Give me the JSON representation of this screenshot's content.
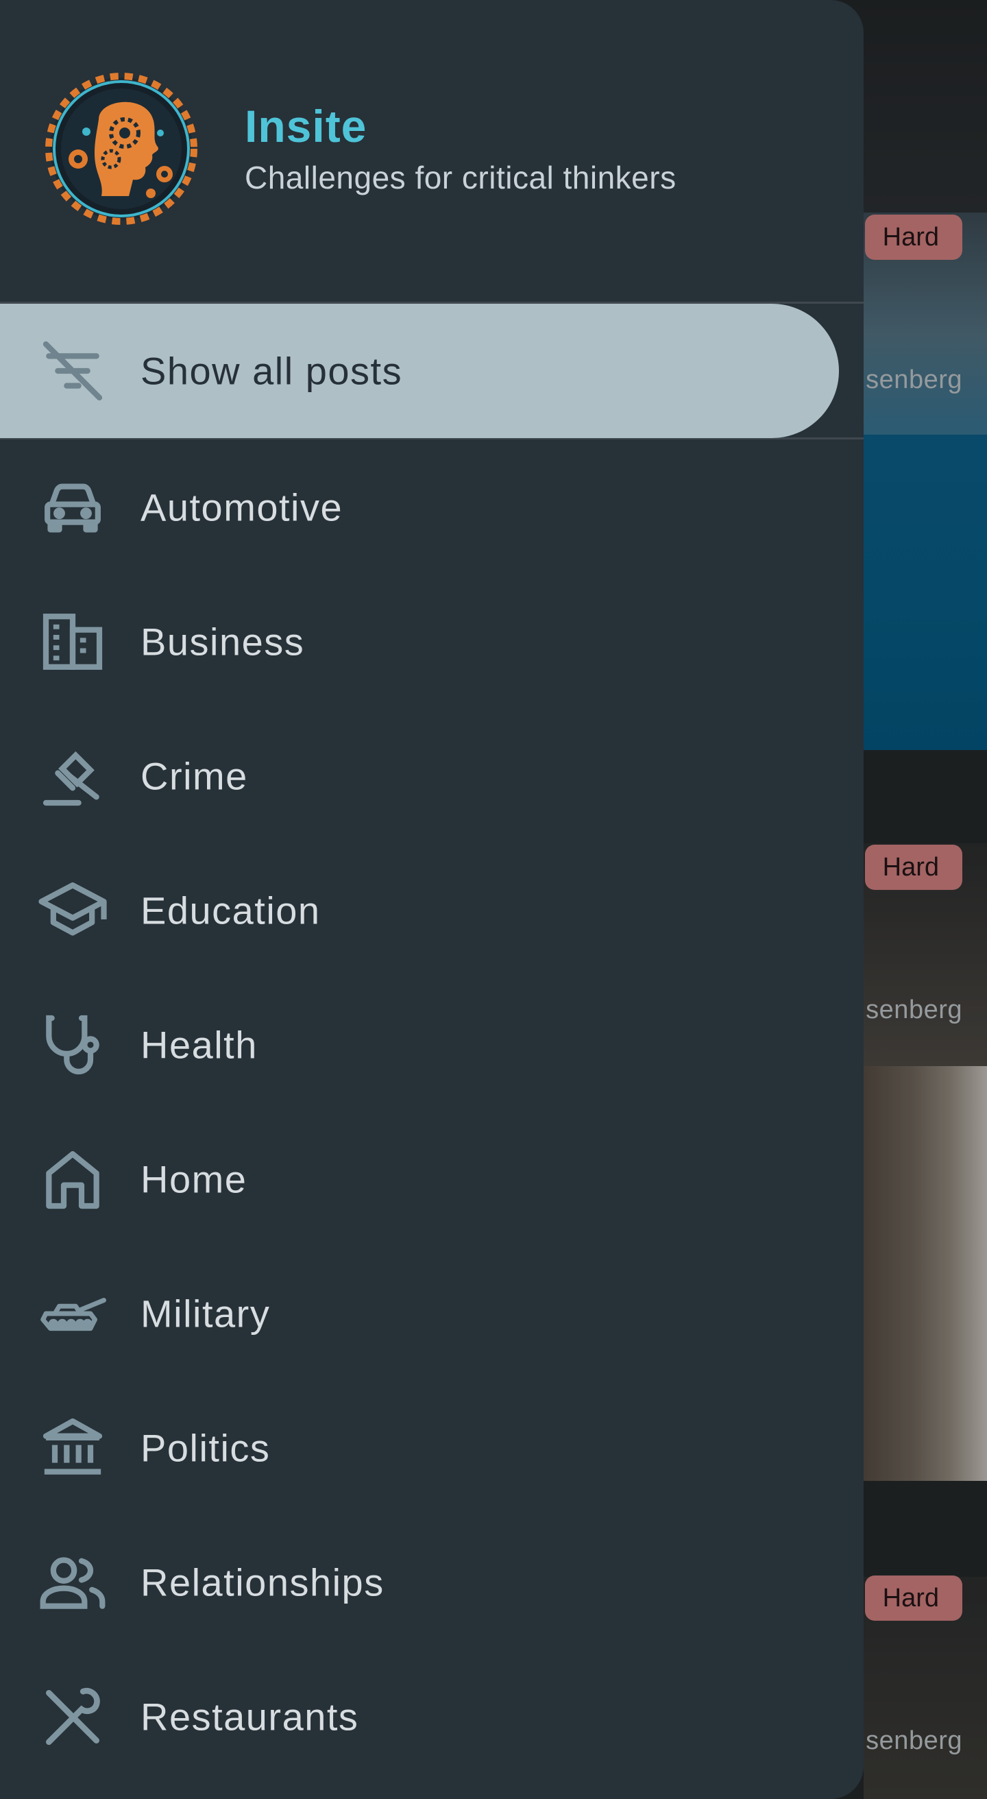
{
  "app": {
    "title": "Insite",
    "subtitle": "Challenges for critical thinkers",
    "logo_icon": "gear-head-logo"
  },
  "colors": {
    "drawer_bg": "#273138",
    "title_accent": "#4fc4d8",
    "active_item_bg": "#aebfc6",
    "icon_color": "#7f96a1",
    "badge_bg": "#c97b7b"
  },
  "drawer": {
    "items": [
      {
        "label": "Show all posts",
        "icon": "filter-off-icon",
        "active": true
      },
      {
        "label": "Automotive",
        "icon": "car-icon"
      },
      {
        "label": "Business",
        "icon": "business-building-icon"
      },
      {
        "label": "Crime",
        "icon": "gavel-icon"
      },
      {
        "label": "Education",
        "icon": "school-cap-icon"
      },
      {
        "label": "Health",
        "icon": "stethoscope-icon"
      },
      {
        "label": "Home",
        "icon": "house-icon"
      },
      {
        "label": "Military",
        "icon": "tank-icon"
      },
      {
        "label": "Politics",
        "icon": "bank-columns-icon"
      },
      {
        "label": "Relationships",
        "icon": "people-icon"
      },
      {
        "label": "Restaurants",
        "icon": "utensils-icon"
      }
    ]
  },
  "feed": {
    "cards": [
      {
        "badge": "Hard",
        "author_fragment": "senberg"
      },
      {
        "badge": "Hard",
        "author_fragment": "senberg"
      },
      {
        "badge": "Hard",
        "author_fragment": "senberg"
      }
    ]
  }
}
